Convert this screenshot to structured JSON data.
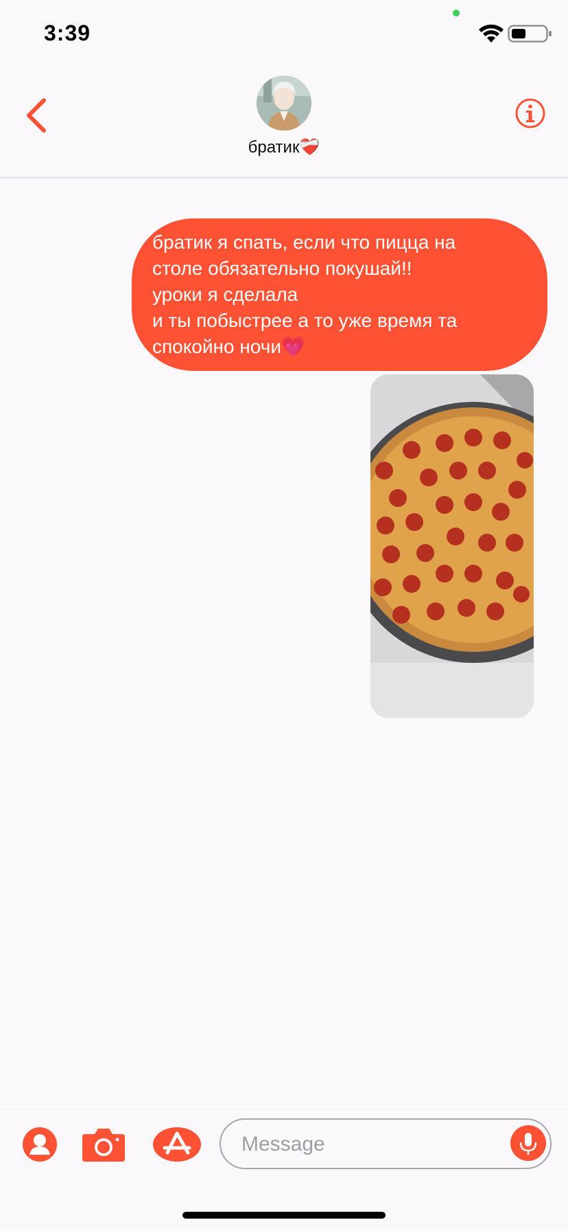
{
  "status_bar": {
    "time": "3:39",
    "icons": [
      "privacy-dot",
      "wifi-icon",
      "battery-icon"
    ]
  },
  "header": {
    "back_icon": "chevron-left-icon",
    "contact_name": "братик❤️‍🩹",
    "info_icon": "info-icon"
  },
  "messages": [
    {
      "type": "text",
      "direction": "outgoing",
      "text": "братик я спать, если что пицца на\nстоле обязательно покушай!!\nуроки я сделала\nи ты побыстрее а то уже время та\nспокойно ночи💗"
    },
    {
      "type": "image",
      "direction": "outgoing",
      "subject": "pepperoni-pizza-photo"
    }
  ],
  "compose": {
    "placeholder": "Message",
    "value": "",
    "apps": [
      "memoji-icon",
      "camera-icon",
      "app-store-icon"
    ],
    "mic_icon": "microphone-icon"
  },
  "colors": {
    "accent": "#ff5133",
    "background": "#faf8fb",
    "bubble_text": "#ffffff",
    "divider": "#e6e4ea"
  }
}
